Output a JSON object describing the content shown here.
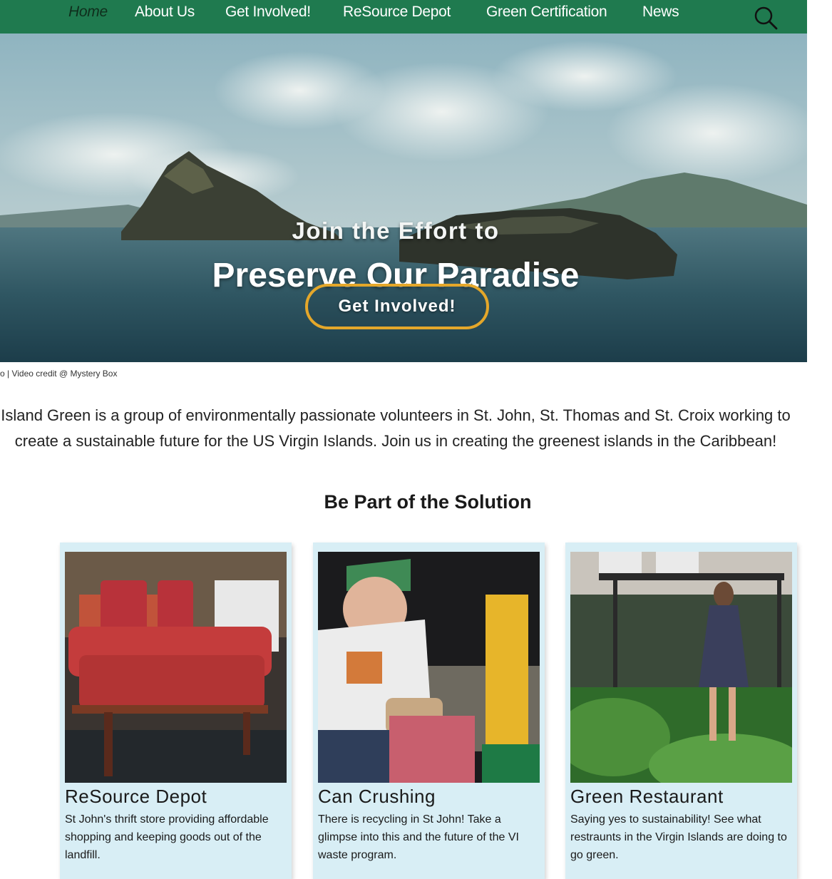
{
  "nav": {
    "items": [
      {
        "label": "Home",
        "active": true
      },
      {
        "label": "About Us"
      },
      {
        "label": "Get Involved!"
      },
      {
        "label": "ReSource Depot"
      },
      {
        "label": "Green Certification"
      },
      {
        "label": "News"
      }
    ],
    "search_icon": "search-icon"
  },
  "hero": {
    "line1": "Join the Effort to",
    "line2": "Preserve Our Paradise",
    "button_label": "Get Involved!"
  },
  "credit": "oto | Video credit @ Mystery Box",
  "intro": "Island Green is a group of environmentally passionate volunteers in St. John, St. Thomas and St. Croix working to create a sustainable future for the US Virgin Islands. Join us in creating the greenest islands in the Caribbean!",
  "section_title": "Be Part of the Solution",
  "cards": [
    {
      "title": "ReSource Depot",
      "description": "St John's thrift store providing affordable shopping and keeping goods out of the landfill."
    },
    {
      "title": "Can Crushing",
      "description": "There is recycling in St John! Take a glimpse into this and the future of the VI waste program."
    },
    {
      "title": "Green Restaurant",
      "description": "Saying yes to sustainability! See what restraunts in the Virgin Islands are doing to go green."
    }
  ],
  "colors": {
    "nav_bg": "#1f7a4f",
    "accent": "#e4a72a",
    "card_bg": "#d8eef5"
  }
}
